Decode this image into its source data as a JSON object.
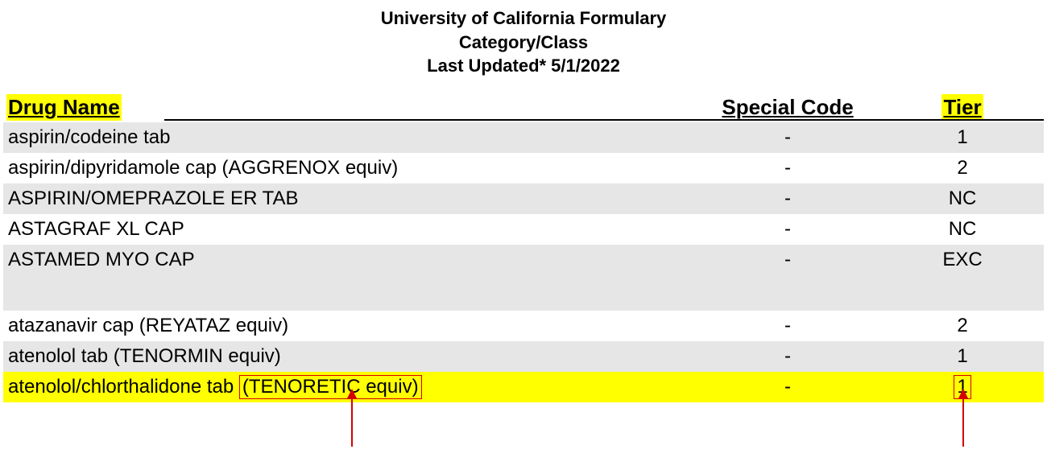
{
  "header": {
    "line1": "University of California Formulary",
    "line2": "Category/Class",
    "line3": "Last Updated* 5/1/2022"
  },
  "columns": {
    "name": "Drug Name",
    "code": "Special Code",
    "tier": "Tier"
  },
  "rows": [
    {
      "name": "aspirin/codeine tab",
      "code": "-",
      "tier": "1",
      "shade": true
    },
    {
      "name": "aspirin/dipyridamole cap (AGGRENOX equiv)",
      "code": "-",
      "tier": "2",
      "shade": false
    },
    {
      "name": "ASPIRIN/OMEPRAZOLE ER TAB",
      "code": "-",
      "tier": "NC",
      "shade": true
    },
    {
      "name": "ASTAGRAF XL CAP",
      "code": "-",
      "tier": "NC",
      "shade": false
    },
    {
      "name": "ASTAMED MYO CAP",
      "code": "-",
      "tier": "EXC",
      "shade": true
    },
    {
      "gap": true
    },
    {
      "name": "atazanavir cap (REYATAZ equiv)",
      "code": "-",
      "tier": "2",
      "shade": false
    },
    {
      "name": "atenolol tab (TENORMIN equiv)",
      "code": "-",
      "tier": "1",
      "shade": true
    }
  ],
  "highlight_row": {
    "name_prefix": "atenolol/chlorthalidone tab ",
    "name_boxed": "(TENORETIC equiv)",
    "code": "-",
    "tier": "1"
  }
}
